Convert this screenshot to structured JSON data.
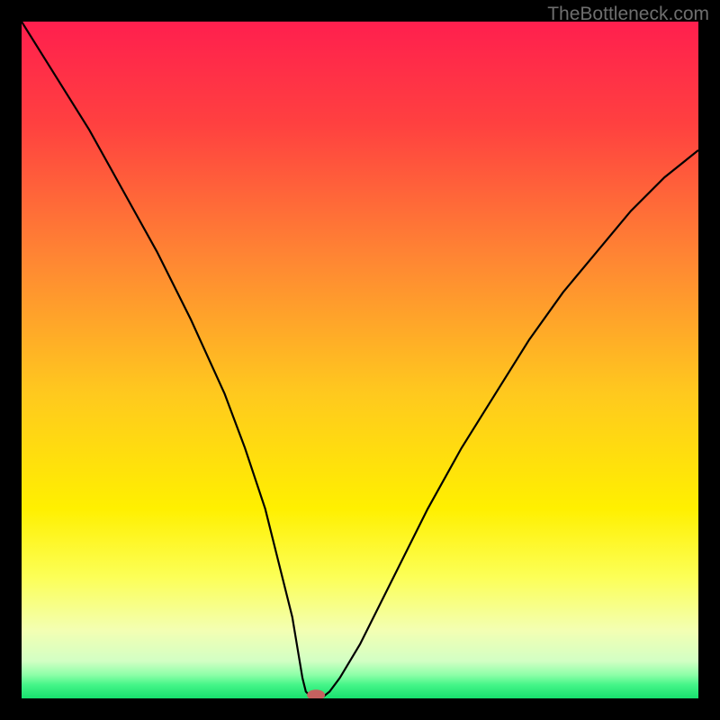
{
  "watermark": "TheBottleneck.com",
  "chart_data": {
    "type": "line",
    "title": "",
    "xlabel": "",
    "ylabel": "",
    "x_range": [
      0,
      100
    ],
    "y_range": [
      0,
      100
    ],
    "curve_points": [
      {
        "x": 0,
        "y": 100
      },
      {
        "x": 5,
        "y": 92
      },
      {
        "x": 10,
        "y": 84
      },
      {
        "x": 15,
        "y": 75
      },
      {
        "x": 20,
        "y": 66
      },
      {
        "x": 25,
        "y": 56
      },
      {
        "x": 30,
        "y": 45
      },
      {
        "x": 33,
        "y": 37
      },
      {
        "x": 36,
        "y": 28
      },
      {
        "x": 38,
        "y": 20
      },
      {
        "x": 40,
        "y": 12
      },
      {
        "x": 41,
        "y": 6
      },
      {
        "x": 41.5,
        "y": 3
      },
      {
        "x": 42,
        "y": 1
      },
      {
        "x": 42.8,
        "y": 0.2
      },
      {
        "x": 44.5,
        "y": 0.2
      },
      {
        "x": 45.5,
        "y": 1
      },
      {
        "x": 47,
        "y": 3
      },
      {
        "x": 50,
        "y": 8
      },
      {
        "x": 55,
        "y": 18
      },
      {
        "x": 60,
        "y": 28
      },
      {
        "x": 65,
        "y": 37
      },
      {
        "x": 70,
        "y": 45
      },
      {
        "x": 75,
        "y": 53
      },
      {
        "x": 80,
        "y": 60
      },
      {
        "x": 85,
        "y": 66
      },
      {
        "x": 90,
        "y": 72
      },
      {
        "x": 95,
        "y": 77
      },
      {
        "x": 100,
        "y": 81
      }
    ],
    "marker": {
      "x": 43.5,
      "y": 0.5,
      "color": "#c6615f"
    },
    "gradient_stops": [
      {
        "offset": 0,
        "color": "#ff1f4e"
      },
      {
        "offset": 0.15,
        "color": "#ff4040"
      },
      {
        "offset": 0.35,
        "color": "#ff8633"
      },
      {
        "offset": 0.55,
        "color": "#ffc91e"
      },
      {
        "offset": 0.72,
        "color": "#fff000"
      },
      {
        "offset": 0.82,
        "color": "#fcff56"
      },
      {
        "offset": 0.9,
        "color": "#f3ffb3"
      },
      {
        "offset": 0.945,
        "color": "#d2ffc4"
      },
      {
        "offset": 0.965,
        "color": "#8effa8"
      },
      {
        "offset": 0.98,
        "color": "#44f588"
      },
      {
        "offset": 1.0,
        "color": "#17e06e"
      }
    ]
  }
}
